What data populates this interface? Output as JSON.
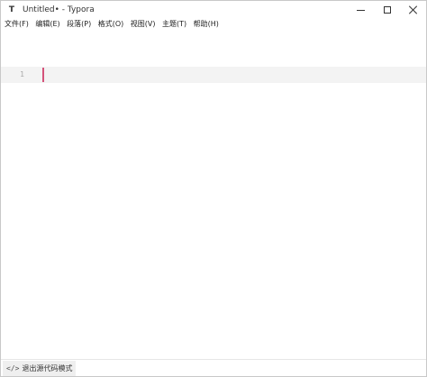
{
  "window": {
    "app_icon": "T",
    "title": "Untitled• - Typora",
    "controls": [
      "minimize-icon",
      "maximize-icon",
      "close-icon"
    ]
  },
  "menubar": {
    "items": [
      {
        "label": "文件(F)"
      },
      {
        "label": "编辑(E)"
      },
      {
        "label": "段落(P)"
      },
      {
        "label": "格式(O)"
      },
      {
        "label": "视图(V)"
      },
      {
        "label": "主题(T)"
      },
      {
        "label": "帮助(H)"
      }
    ]
  },
  "editor": {
    "line_number": "1",
    "caret_color": "#d4537a",
    "active_line_bg": "#f3f3f3"
  },
  "statusbar": {
    "source_icon": "</>",
    "source_mode_label": "退出源代码模式"
  }
}
